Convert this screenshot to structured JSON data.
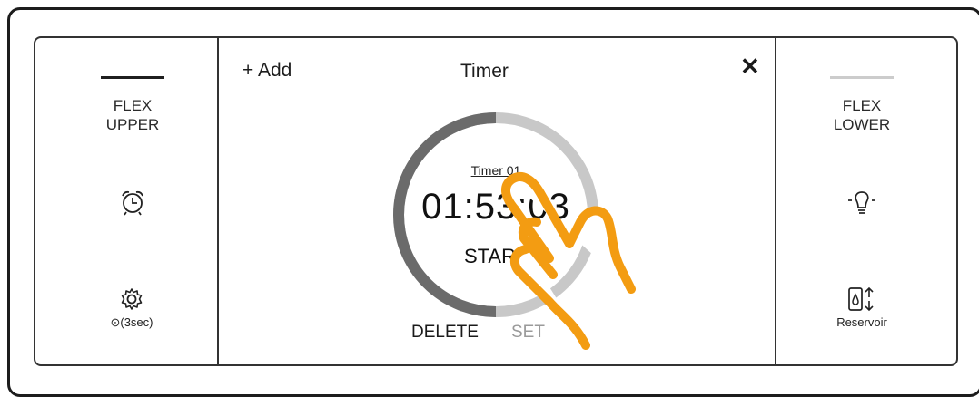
{
  "left_panel": {
    "label_line1": "FLEX",
    "label_line2": "UPPER",
    "lock_text": "⊙(3sec)"
  },
  "main": {
    "add_label": "+ Add",
    "title": "Timer",
    "close_symbol": "✕",
    "timer": {
      "name": "Timer 01",
      "time": "01:53:03",
      "start_label": "START",
      "progress": 0.5
    },
    "delete_label": "DELETE",
    "set_label": "SET"
  },
  "right_panel": {
    "label_line1": "FLEX",
    "label_line2": "LOWER",
    "reservoir_label": "Reservoir"
  },
  "colors": {
    "hand": "#F39C12",
    "ring_dark": "#6b6b6b",
    "ring_light": "#c8c8c8",
    "upper_bar": "#1f1f1f",
    "lower_bar": "#cccccc",
    "set_text": "#9a9a9a"
  }
}
